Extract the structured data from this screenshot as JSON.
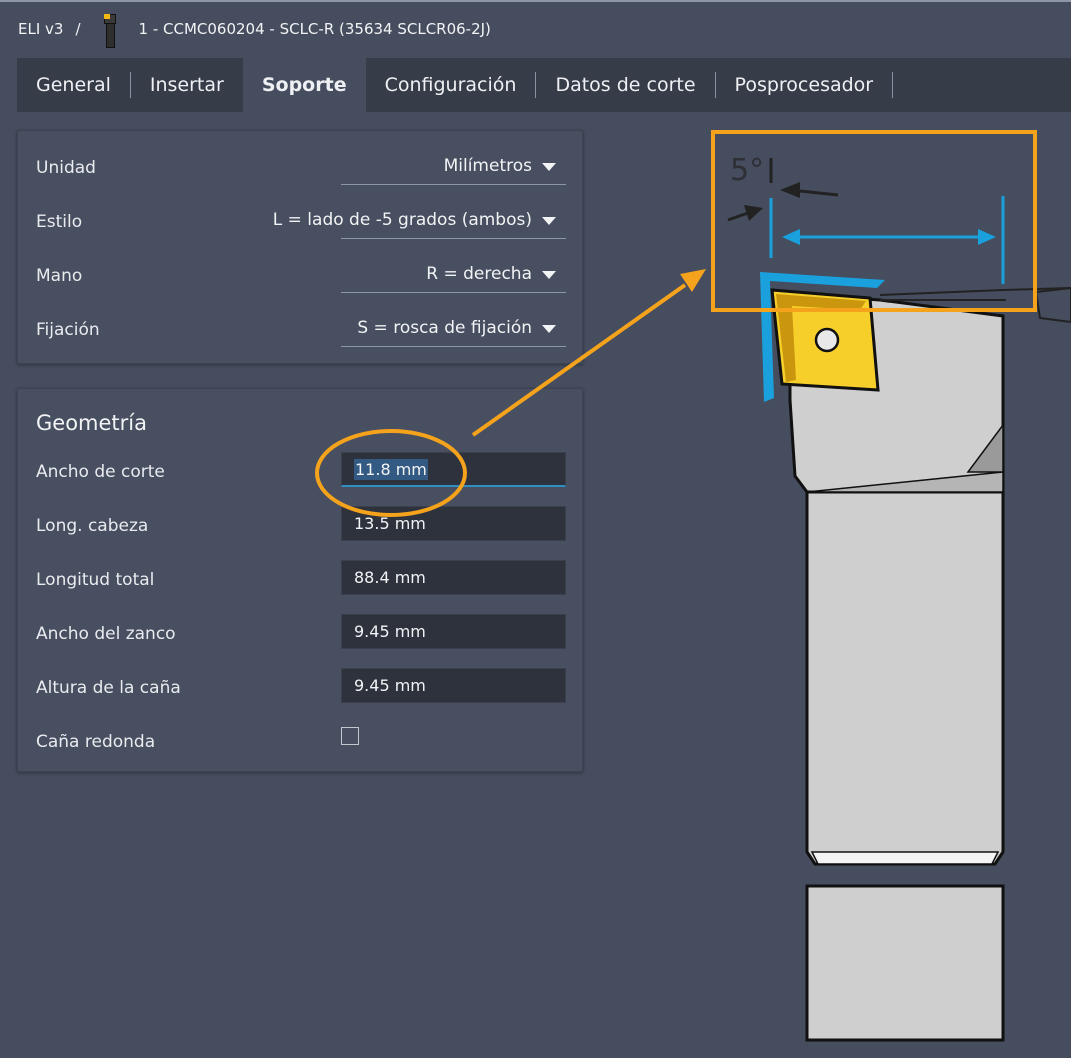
{
  "breadcrumb": {
    "app": "ELI v3",
    "separator": "/",
    "tool_title": "1 - CCMC060204 - SCLC-R (35634 SCLCR06-2J)"
  },
  "tabs": [
    "General",
    "Insertar",
    "Soporte",
    "Configuración",
    "Datos de corte",
    "Posprocesador"
  ],
  "active_tab": "Soporte",
  "settings": {
    "unidad": {
      "label": "Unidad",
      "value": "Milímetros"
    },
    "estilo": {
      "label": "Estilo",
      "value": "L = lado de -5 grados (ambos)"
    },
    "mano": {
      "label": "Mano",
      "value": "R = derecha"
    },
    "fijacion": {
      "label": "Fijación",
      "value": "S = rosca de fijación"
    }
  },
  "geometry": {
    "title": "Geometría",
    "ancho_corte": {
      "label": "Ancho de corte",
      "value": "11.8 mm"
    },
    "long_cabeza": {
      "label": "Long. cabeza",
      "value": "13.5 mm"
    },
    "longitud_total": {
      "label": "Longitud total",
      "value": "88.4 mm"
    },
    "ancho_zanco": {
      "label": "Ancho del zanco",
      "value": "9.45 mm"
    },
    "altura_cana": {
      "label": "Altura de la caña",
      "value": "9.45 mm"
    },
    "cana_redonda": {
      "label": "Caña redonda",
      "checked": false
    }
  },
  "diagram": {
    "angle_label": "5°"
  },
  "colors": {
    "background": "#454d5e",
    "tab_bar": "#363c48",
    "highlight_orange": "#f5a31c",
    "dimension_blue": "#1aa0dc",
    "insert_yellow": "#f6cf2a"
  }
}
